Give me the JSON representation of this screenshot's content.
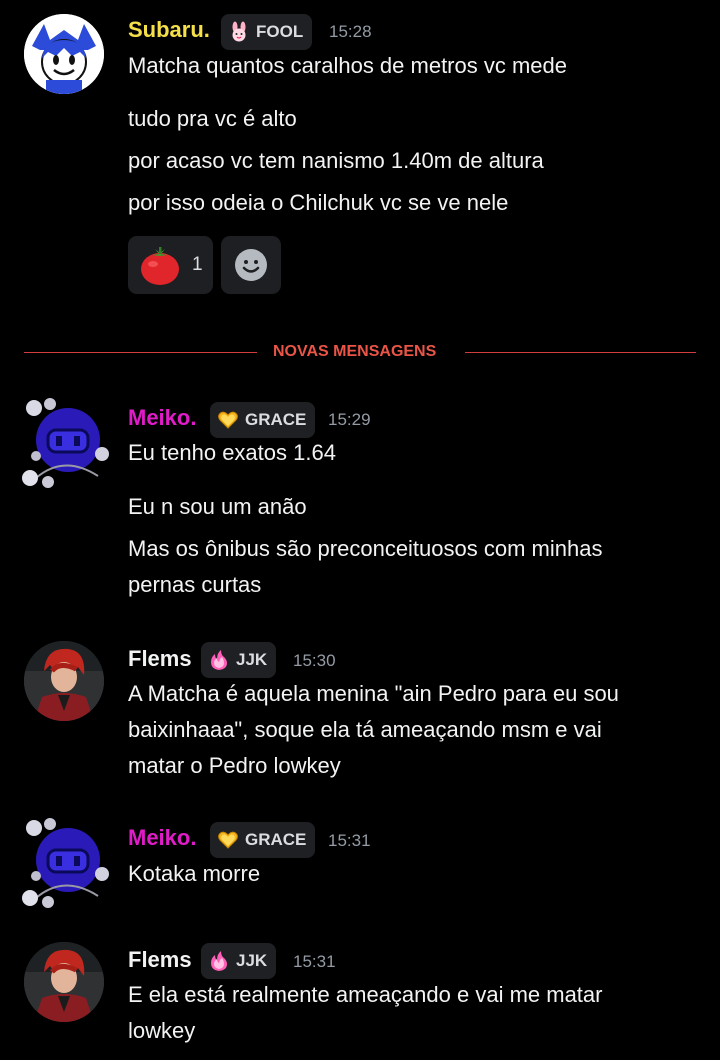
{
  "messages": [
    {
      "author": "Subaru.",
      "author_color": "#f5e04a",
      "badge": {
        "label": "FOOL",
        "icon": "bunny-icon"
      },
      "time": "15:28",
      "lines": [
        "Matcha quantos caralhos de metros vc mede",
        "tudo pra vc é alto",
        "por acaso vc tem nanismo 1.40m de altura",
        "por isso odeia o Chilchuk vc se ve nele"
      ],
      "reactions": [
        {
          "icon": "tomato-icon",
          "count": "1"
        },
        {
          "icon": "add-reaction-icon"
        }
      ]
    },
    {
      "author": "Meiko.",
      "author_color": "#e01bc8",
      "badge": {
        "label": "GRACE",
        "icon": "heart-icon"
      },
      "time": "15:29",
      "lines": [
        "Eu tenho exatos 1.64",
        "Eu n sou um anão",
        "Mas os ônibus são preconceituosos com minhas",
        "pernas curtas"
      ]
    },
    {
      "author": "Flems",
      "author_color": "#f2f3f5",
      "badge": {
        "label": "JJK",
        "icon": "flame-icon"
      },
      "time": "15:30",
      "lines": [
        "A Matcha é aquela menina \"ain Pedro para eu sou",
        "baixinhaaa\", soque ela tá ameaçando msm e vai",
        "matar o Pedro lowkey"
      ]
    },
    {
      "author": "Meiko.",
      "author_color": "#e01bc8",
      "badge": {
        "label": "GRACE",
        "icon": "heart-icon"
      },
      "time": "15:31",
      "lines": [
        "Kotaka morre"
      ]
    },
    {
      "author": "Flems",
      "author_color": "#f2f3f5",
      "badge": {
        "label": "JJK",
        "icon": "flame-icon"
      },
      "time": "15:31",
      "lines": [
        "E ela está realmente ameaçando e vai me matar",
        "lowkey"
      ]
    }
  ],
  "divider": {
    "label": "NOVAS MENSAGENS",
    "color": "#ea5548"
  }
}
